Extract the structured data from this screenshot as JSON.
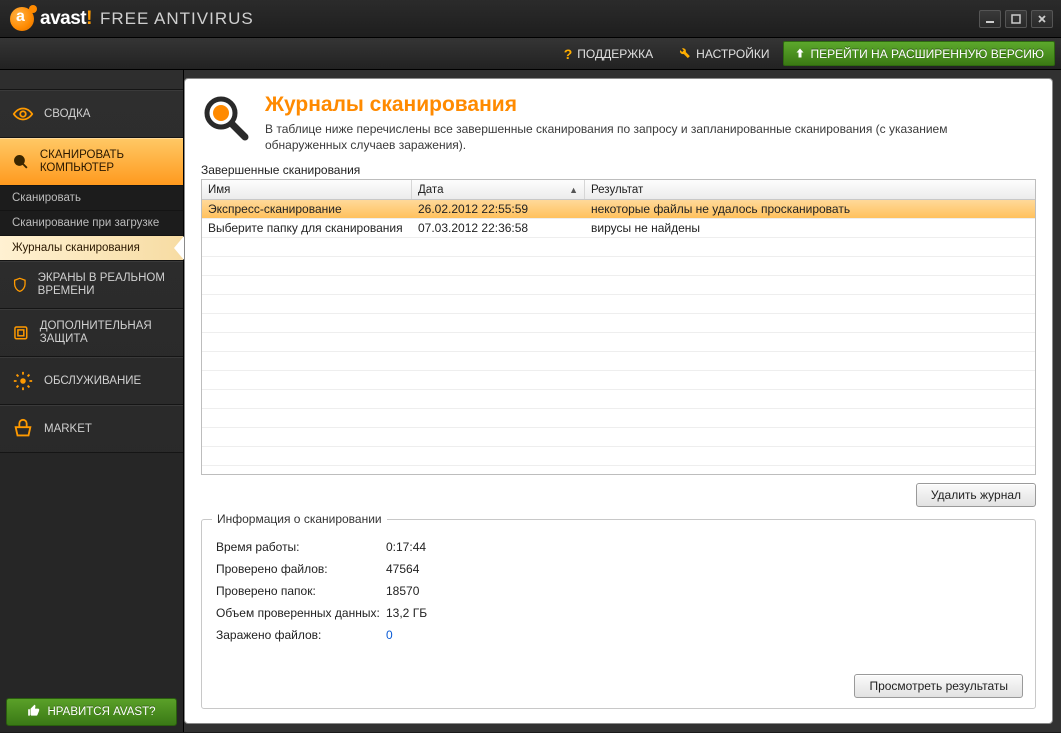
{
  "titlebar": {
    "brand": "avast",
    "brand_punct": "!",
    "edition": "FREE ANTIVIRUS"
  },
  "menubar": {
    "support": "ПОДДЕРЖКА",
    "settings": "НАСТРОЙКИ",
    "upgrade": "ПЕРЕЙТИ НА РАСШИРЕННУЮ ВЕРСИЮ"
  },
  "sidebar": {
    "summary": "СВОДКА",
    "scan": "СКАНИРОВАТЬ КОМПЬЮТЕР",
    "sub": {
      "scan_now": "Сканировать",
      "boot_scan": "Сканирование при загрузке",
      "scan_logs": "Журналы сканирования"
    },
    "shields": "ЭКРАНЫ В РЕАЛЬНОМ ВРЕМЕНИ",
    "extra": "ДОПОЛНИТЕЛЬНАЯ ЗАЩИТА",
    "maint": "ОБСЛУЖИВАНИЕ",
    "market": "MARKET",
    "like": "НРАВИТСЯ AVAST?"
  },
  "page": {
    "title": "Журналы сканирования",
    "desc": "В таблице ниже перечислены все завершенные сканирования по запросу и запланированные сканирования (с указанием обнаруженных случаев заражения)."
  },
  "table": {
    "group_label": "Завершенные сканирования",
    "cols": {
      "name": "Имя",
      "date": "Дата",
      "result": "Результат"
    },
    "rows": [
      {
        "name": "Экспресс-сканирование",
        "date": "26.02.2012 22:55:59",
        "result": "некоторые файлы не удалось просканировать",
        "selected": true
      },
      {
        "name": "Выберите папку для сканирования",
        "date": "07.03.2012 22:36:58",
        "result": "вирусы не найдены",
        "selected": false
      }
    ]
  },
  "buttons": {
    "delete_log": "Удалить журнал",
    "view_results": "Просмотреть результаты"
  },
  "info": {
    "legend": "Информация о сканировании",
    "runtime_l": "Время работы:",
    "runtime_v": "0:17:44",
    "files_l": "Проверено файлов:",
    "files_v": "47564",
    "folders_l": "Проверено папок:",
    "folders_v": "18570",
    "data_l": "Объем проверенных данных:",
    "data_v": "13,2 ГБ",
    "infected_l": "Заражено файлов:",
    "infected_v": "0"
  }
}
